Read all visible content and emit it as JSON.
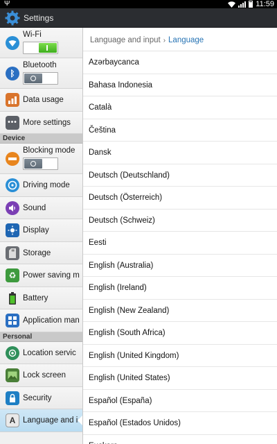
{
  "status_bar": {
    "time": "11:59"
  },
  "app_bar": {
    "title": "Settings"
  },
  "left_panel": {
    "wifi_label": "Wi-Fi",
    "bluetooth_label": "Bluetooth",
    "data_usage_label": "Data usage",
    "more_settings_label": "More settings",
    "device_header": "Device",
    "blocking_mode_label": "Blocking mode",
    "driving_mode_label": "Driving mode",
    "sound_label": "Sound",
    "display_label": "Display",
    "storage_label": "Storage",
    "power_saving_label": "Power saving m",
    "battery_label": "Battery",
    "application_manager_label": "Application man",
    "personal_header": "Personal",
    "location_label": "Location servic",
    "lock_screen_label": "Lock screen",
    "security_label": "Security",
    "language_input_label": "Language and i"
  },
  "toggles": {
    "wifi": "on",
    "bluetooth": "off",
    "blocking_mode": "off"
  },
  "breadcrumb": {
    "parent": "Language and input",
    "separator": "›",
    "current": "Language"
  },
  "languages": [
    "Azərbaycanca",
    "Bahasa Indonesia",
    "Català",
    "Čeština",
    "Dansk",
    "Deutsch (Deutschland)",
    "Deutsch (Österreich)",
    "Deutsch (Schweiz)",
    "Eesti",
    "English (Australia)",
    "English (Ireland)",
    "English (New Zealand)",
    "English (South Africa)",
    "English (United Kingdom)",
    "English (United States)",
    "Español (España)",
    "Español (Estados Unidos)",
    "Euskara"
  ],
  "colors": {
    "accent": "#2673b4",
    "wifi_icon": "#2a8fd6",
    "selected_bg": "#cfe7f6"
  }
}
